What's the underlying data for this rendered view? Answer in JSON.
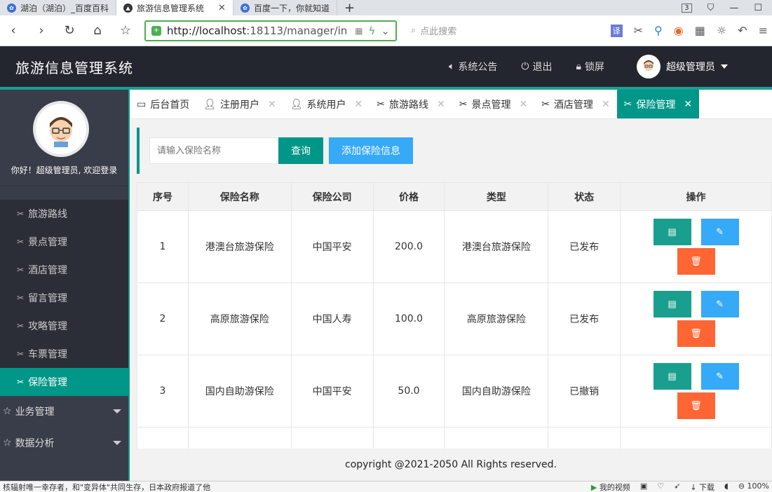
{
  "browser": {
    "tabs": [
      {
        "title": "湖泊（湖泊）_百度百科"
      },
      {
        "title": "旅游信息管理系统"
      },
      {
        "title": "百度一下，你就知道"
      }
    ],
    "new_tab": "+",
    "tab_count": "3",
    "url_host": "http://localhost",
    "url_rest": ":18113/manager/in",
    "search_placeholder": "点此搜索",
    "translate": "译"
  },
  "header": {
    "title": "旅游信息管理系统",
    "announce": "系统公告",
    "logout": "退出",
    "lock": "锁屏",
    "username": "超级管理员"
  },
  "sidebar": {
    "welcome": "你好！超级管理员, 欢迎登录",
    "sub_items": [
      {
        "label": "旅游路线"
      },
      {
        "label": "景点管理"
      },
      {
        "label": "酒店管理"
      },
      {
        "label": "留言管理"
      },
      {
        "label": "攻略管理"
      },
      {
        "label": "车票管理"
      },
      {
        "label": "保险管理"
      }
    ],
    "groups": [
      {
        "label": "业务管理"
      },
      {
        "label": "数据分析"
      }
    ]
  },
  "page_tabs": [
    {
      "label": "后台首页"
    },
    {
      "label": "注册用户"
    },
    {
      "label": "系统用户"
    },
    {
      "label": "旅游路线"
    },
    {
      "label": "景点管理"
    },
    {
      "label": "酒店管理"
    },
    {
      "label": "保险管理"
    }
  ],
  "search": {
    "placeholder": "请输入保险名称",
    "query_btn": "查询",
    "add_btn": "添加保险信息"
  },
  "table": {
    "headers": [
      "序号",
      "保险名称",
      "保险公司",
      "价格",
      "类型",
      "状态",
      "操作"
    ],
    "rows": [
      {
        "no": "1",
        "name": "港澳台旅游保险",
        "company": "中国平安",
        "price": "200.0",
        "type": "港澳台旅游保险",
        "status": "已发布"
      },
      {
        "no": "2",
        "name": "高原旅游保险",
        "company": "中国人寿",
        "price": "100.0",
        "type": "高原旅游保险",
        "status": "已发布"
      },
      {
        "no": "3",
        "name": "国内自助游保险",
        "company": "中国平安",
        "price": "50.0",
        "type": "国内自助游保险",
        "status": "已撤销"
      }
    ]
  },
  "footer": "copyright @2021-2050 All Rights reserved.",
  "statusbar": {
    "left": "核辐射唯一幸存者，和\"变异体\"共同生存，日本政府报道了他",
    "video": "我的视频",
    "download": "下载",
    "zoom": "100%"
  }
}
